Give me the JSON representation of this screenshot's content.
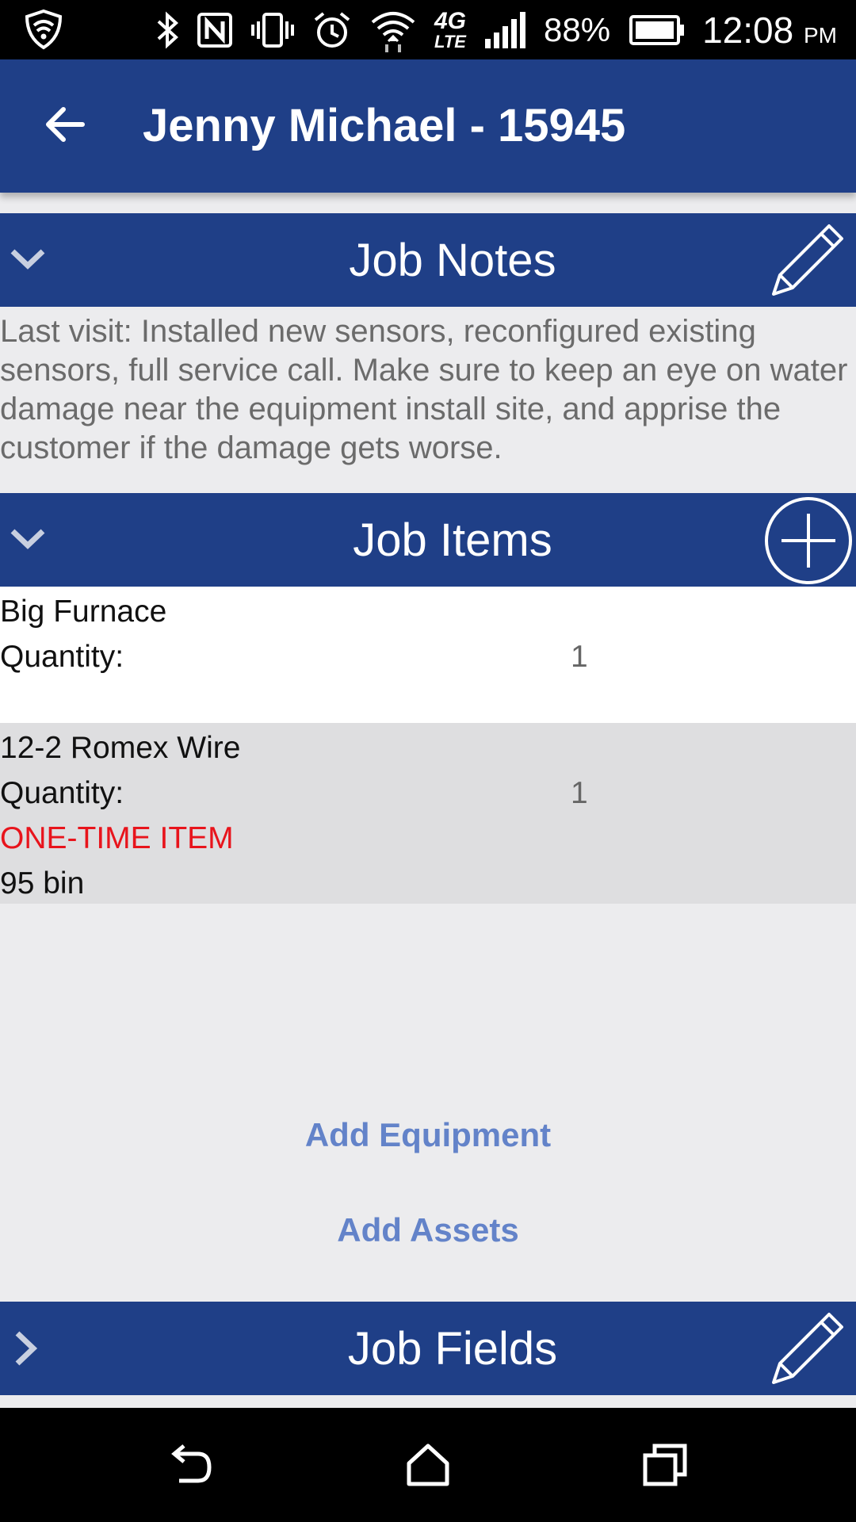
{
  "status_bar": {
    "battery": "88%",
    "time": "12:08",
    "ampm": "PM",
    "network": "4G",
    "network_sub": "LTE"
  },
  "app_bar": {
    "title": "Jenny Michael - 15945"
  },
  "job_notes": {
    "title": "Job Notes",
    "text": "Last visit: Installed new sensors, reconfigured existing sensors, full service call. Make sure to keep an eye on water damage near the equipment install site, and apprise the customer if the damage gets worse."
  },
  "job_items": {
    "title": "Job Items",
    "items": [
      {
        "name": "Big Furnace",
        "quantity_label": "Quantity:",
        "quantity": "1"
      },
      {
        "name": "12-2 Romex Wire",
        "quantity_label": "Quantity:",
        "quantity": "1",
        "tag": "ONE-TIME ITEM",
        "location": "95 bin"
      }
    ]
  },
  "actions": {
    "add_equipment": "Add Equipment",
    "add_assets": "Add Assets"
  },
  "job_fields": {
    "title": "Job Fields"
  },
  "colors": {
    "header_blue": "#1f3f87",
    "link_blue": "#6383c9",
    "alert_red": "#e8141c",
    "background": "#ececee"
  }
}
